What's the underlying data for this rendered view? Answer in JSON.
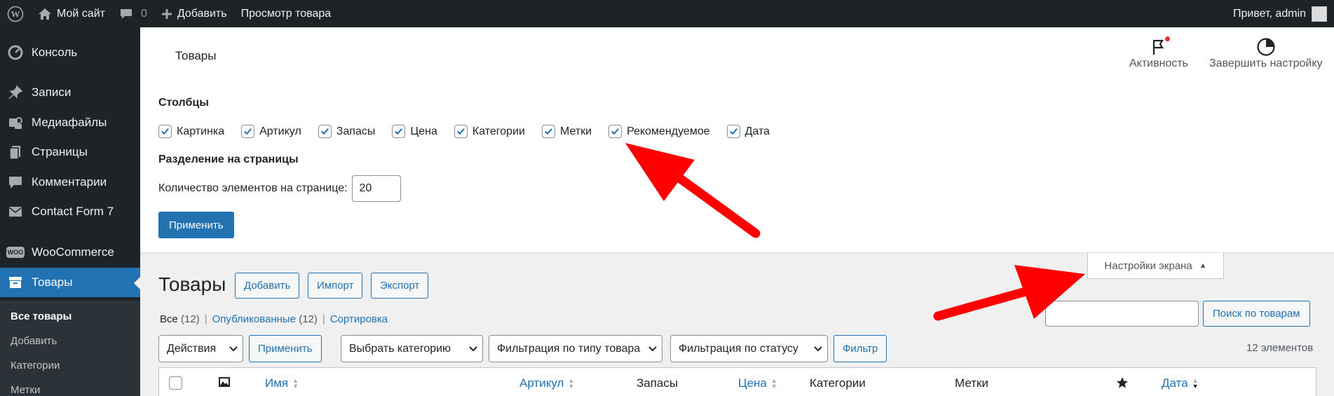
{
  "admin_bar": {
    "site_name": "Мой сайт",
    "comments_count": "0",
    "add_new": "Добавить",
    "view_product": "Просмотр товара",
    "greeting": "Привет, admin"
  },
  "sidebar": {
    "items": [
      {
        "label": "Консоль",
        "icon": "dashboard-icon"
      },
      {
        "label": "Записи",
        "icon": "pin-icon"
      },
      {
        "label": "Медиафайлы",
        "icon": "media-icon"
      },
      {
        "label": "Страницы",
        "icon": "pages-icon"
      },
      {
        "label": "Комментарии",
        "icon": "comment-icon"
      },
      {
        "label": "Contact Form 7",
        "icon": "mail-icon"
      },
      {
        "label": "WooCommerce",
        "icon": "woo-icon",
        "badge": "WOO"
      },
      {
        "label": "Товары",
        "icon": "archive-icon",
        "active": true
      }
    ],
    "submenu": [
      "Все товары",
      "Добавить",
      "Категории",
      "Метки"
    ]
  },
  "header": {
    "title": "Товары",
    "activity_label": "Активность",
    "finish_setup_label": "Завершить настройку"
  },
  "screen_options": {
    "columns_heading": "Столбцы",
    "columns": [
      {
        "label": "Картинка",
        "checked": true
      },
      {
        "label": "Артикул",
        "checked": true
      },
      {
        "label": "Запасы",
        "checked": true
      },
      {
        "label": "Цена",
        "checked": true
      },
      {
        "label": "Категории",
        "checked": true
      },
      {
        "label": "Метки",
        "checked": true
      },
      {
        "label": "Рекомендуемое",
        "checked": true
      },
      {
        "label": "Дата",
        "checked": true
      }
    ],
    "pagination_heading": "Разделение на страницы",
    "per_page_label": "Количество элементов на странице:",
    "per_page_value": "20",
    "apply_label": "Применить",
    "tab_label": "Настройки экрана"
  },
  "main": {
    "title": "Товары",
    "buttons": [
      "Добавить",
      "Импорт",
      "Экспорт"
    ],
    "views": {
      "all": "Все",
      "all_count": "(12)",
      "published": "Опубликованные",
      "published_count": "(12)",
      "sorting": "Сортировка"
    },
    "search_button": "Поиск по товарам",
    "bulk_actions": "Действия",
    "bulk_apply": "Применить",
    "category_filter": "Выбрать категорию",
    "type_filter": "Фильтрация по типу товара",
    "status_filter": "Фильтрация по статусу",
    "filter_button": "Фильтр",
    "items_count": "12 элементов"
  },
  "table": {
    "columns": {
      "name": "Имя",
      "sku": "Артикул",
      "stock": "Запасы",
      "price": "Цена",
      "categories": "Категории",
      "tags": "Метки",
      "date": "Дата"
    }
  },
  "colors": {
    "admin_dark": "#1d2327",
    "accent": "#2271b1",
    "annotation_arrow": "#ff0000"
  }
}
